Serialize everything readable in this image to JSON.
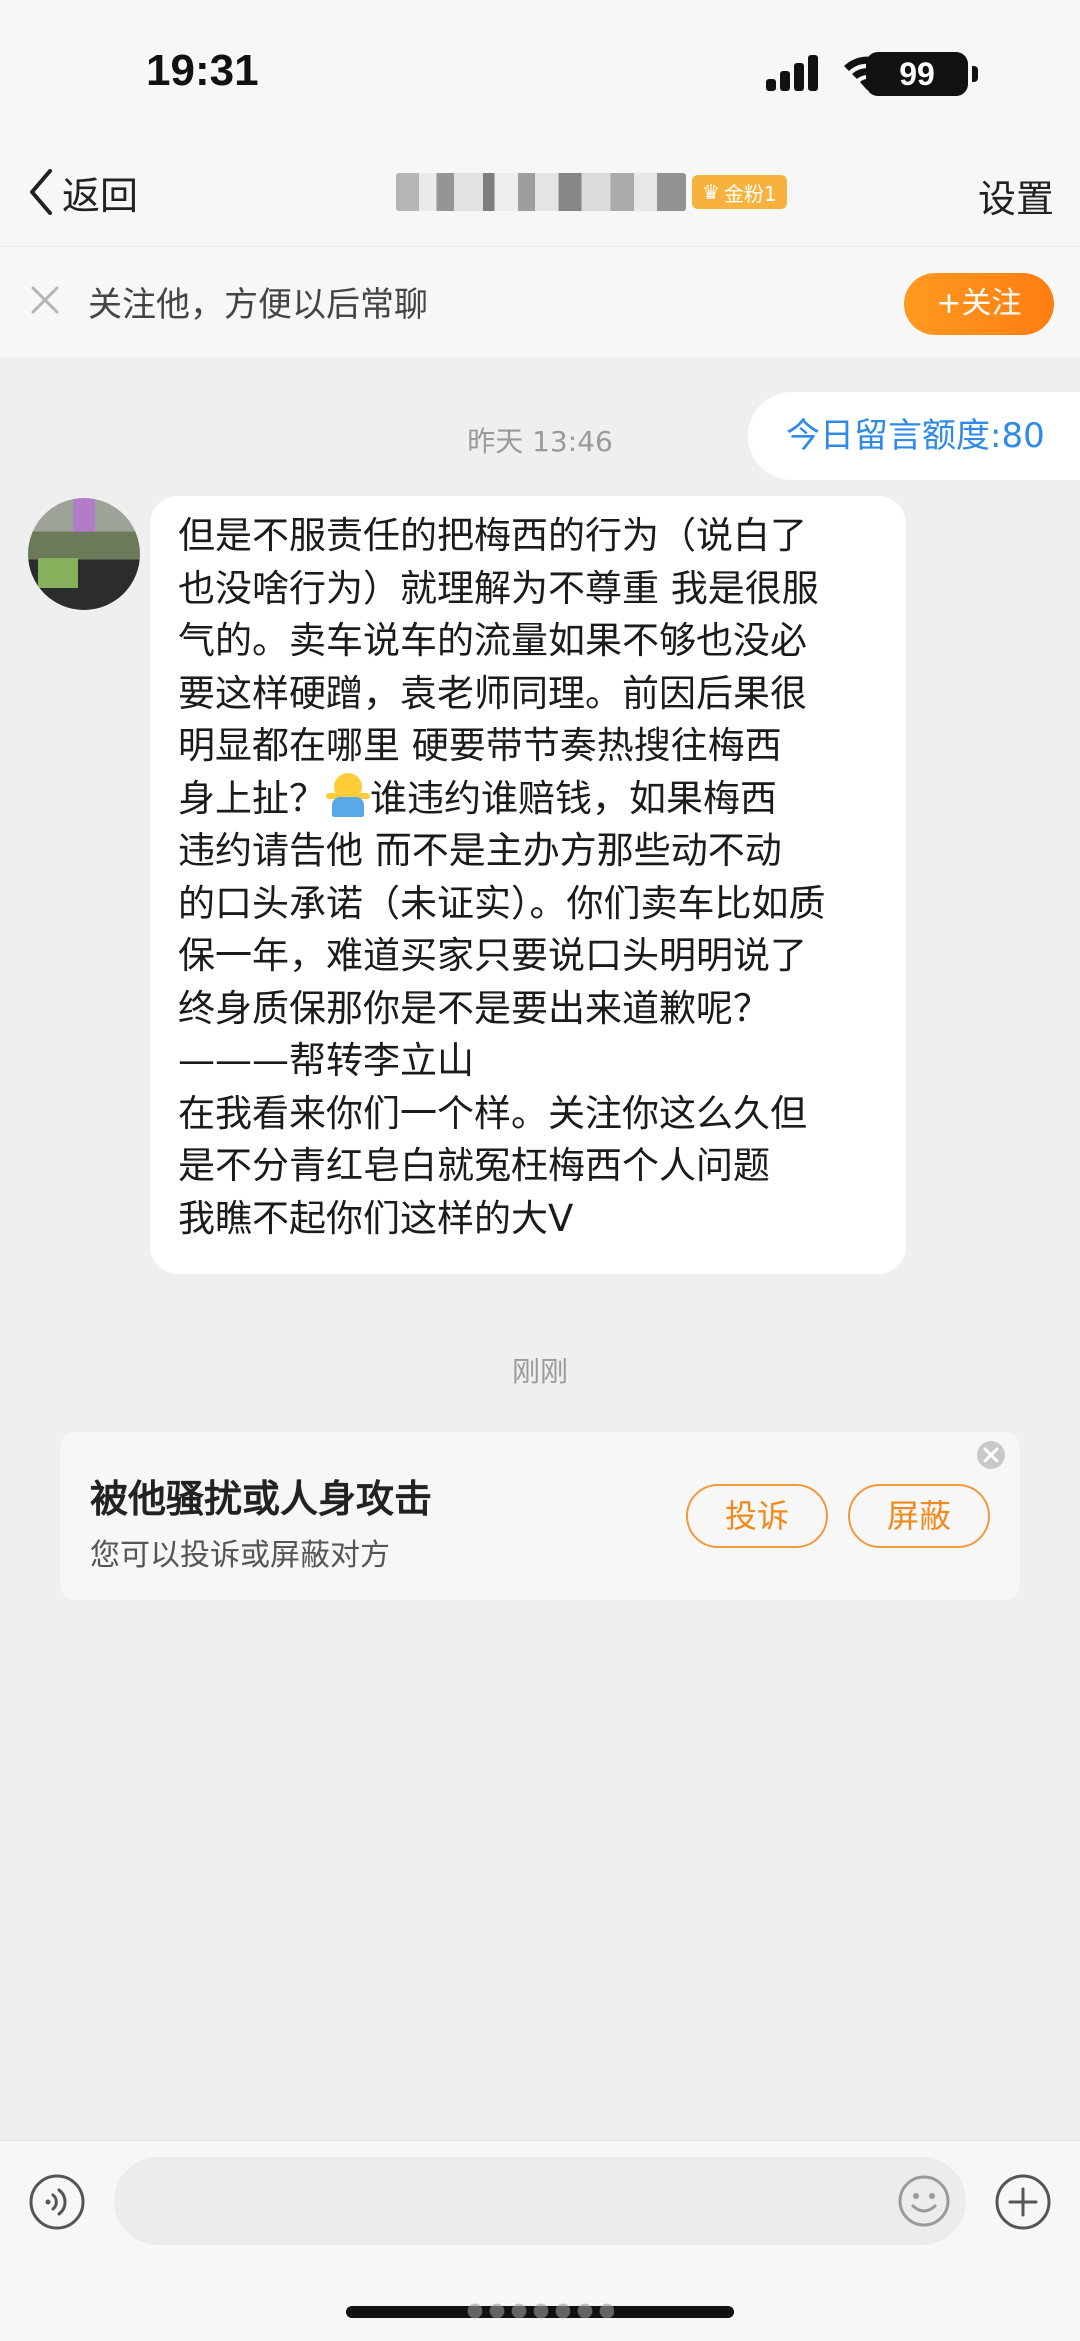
{
  "status_bar": {
    "time": "19:31",
    "battery": "99"
  },
  "nav": {
    "back_label": "返回",
    "fan_badge": "金粉1",
    "settings_label": "设置"
  },
  "follow_prompt": {
    "text": "关注他，方便以后常聊",
    "follow_button": "+关注"
  },
  "messages": {
    "timestamp_1": "昨天 13:46",
    "quota": "今日留言额度:80",
    "bubble_lines": [
      "但是不服责任的把梅西的行为（说白了",
      "也没啥行为）就理解为不尊重 我是很服",
      "气的。卖车说车的流量如果不够也没必",
      "要这样硬蹭，袁老师同理。前因后果很",
      "明显都在哪里 硬要带节奏热搜往梅西",
      "身上扯？",
      "谁违约谁赔钱，如果梅西",
      "违约请告他 而不是主办方那些动不动",
      "的口头承诺（未证实）。你们卖车比如质",
      "保一年，难道买家只要说口头明明说了",
      "终身质保那你是不是要出来道歉呢？",
      "———帮转李立山",
      "在我看来你们一个样。关注你这么久但",
      "是不分青红皂白就冤枉梅西个人问题",
      "我瞧不起你们这样的大V"
    ],
    "timestamp_2": "刚刚"
  },
  "report_card": {
    "title": "被他骚扰或人身攻击",
    "subtitle": "您可以投诉或屏蔽对方",
    "complain_button": "投诉",
    "block_button": "屏蔽"
  },
  "colors": {
    "accent_orange": "#ff8a1c",
    "link_blue": "#2f8ae8",
    "badge_gold": "#f6b23c"
  }
}
